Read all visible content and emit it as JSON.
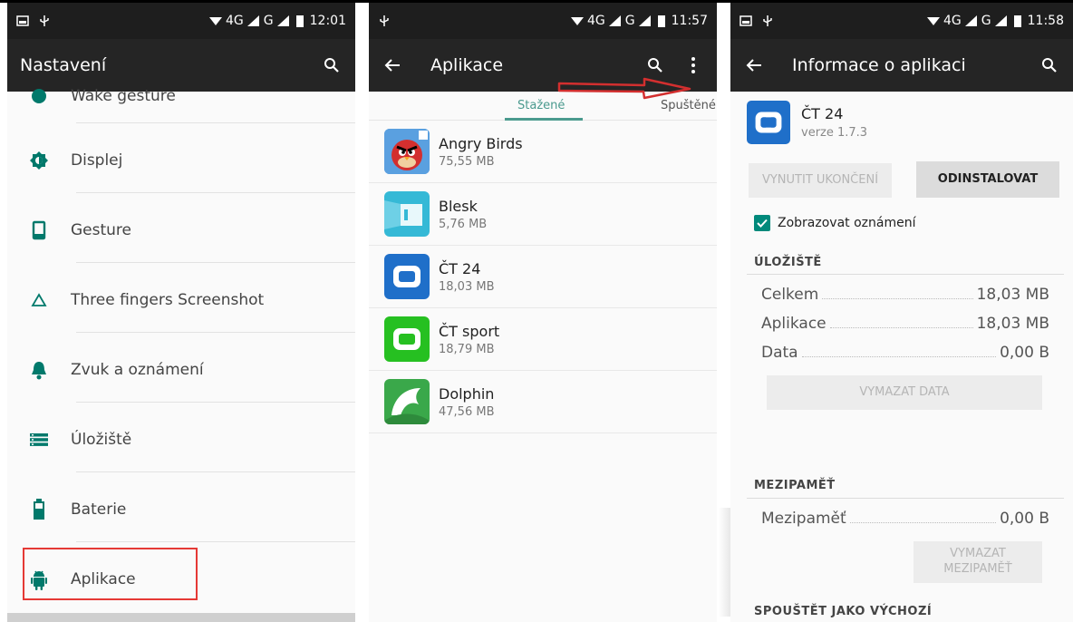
{
  "panel1": {
    "status": {
      "signal": "4G",
      "signal2": "G",
      "time": "12:01"
    },
    "title": "Nastavení",
    "partial_item": "Wake gesture",
    "items": [
      {
        "label": "Displej",
        "icon": "brightness-icon"
      },
      {
        "label": "Gesture",
        "icon": "phone-icon"
      },
      {
        "label": "Three fingers Screenshot",
        "icon": "triangle-icon"
      },
      {
        "label": "Zvuk a oznámení",
        "icon": "bell-icon"
      },
      {
        "label": "Úložiště",
        "icon": "storage-icon"
      },
      {
        "label": "Baterie",
        "icon": "battery-icon"
      },
      {
        "label": "Aplikace",
        "icon": "android-icon"
      }
    ],
    "accent_color": "#00796b",
    "highlight_color": "#e53935"
  },
  "panel2": {
    "status": {
      "signal": "4G",
      "signal2": "G",
      "time": "11:57"
    },
    "title": "Aplikace",
    "tabs": {
      "active": "Stažené",
      "next": "Spuštěné"
    },
    "apps": [
      {
        "name": "Angry Birds",
        "size": "75,55 MB",
        "icon": "angry-birds-icon"
      },
      {
        "name": "Blesk",
        "size": "5,76 MB",
        "icon": "blesk-icon"
      },
      {
        "name": "ČT 24",
        "size": "18,03 MB",
        "icon": "ct24-icon"
      },
      {
        "name": "ČT sport",
        "size": "18,79 MB",
        "icon": "ct-sport-icon"
      },
      {
        "name": "Dolphin",
        "size": "47,56 MB",
        "icon": "dolphin-icon"
      }
    ]
  },
  "panel3": {
    "status": {
      "signal": "4G",
      "signal2": "G",
      "time": "11:58"
    },
    "title": "Informace o aplikaci",
    "app_name": "ČT 24",
    "app_version": "verze 1.7.3",
    "force_stop": "VYNUTIT UKONČENÍ",
    "uninstall": "ODINSTALOVAT",
    "notifications_label": "Zobrazovat oznámení",
    "storage_heading": "ÚLOŽIŠTĚ",
    "storage": [
      {
        "label": "Celkem",
        "value": "18,03 MB"
      },
      {
        "label": "Aplikace",
        "value": "18,03 MB"
      },
      {
        "label": "Data",
        "value": "0,00 B"
      }
    ],
    "clear_data": "VYMAZAT DATA",
    "cache_heading": "MEZIPAMĚŤ",
    "cache": {
      "label": "Mezipaměť",
      "value": "0,00 B"
    },
    "clear_cache_line1": "VYMAZAT",
    "clear_cache_line2": "MEZIPAMĚŤ",
    "launch_heading": "SPOUŠTĚT JAKO VÝCHOZÍ"
  }
}
